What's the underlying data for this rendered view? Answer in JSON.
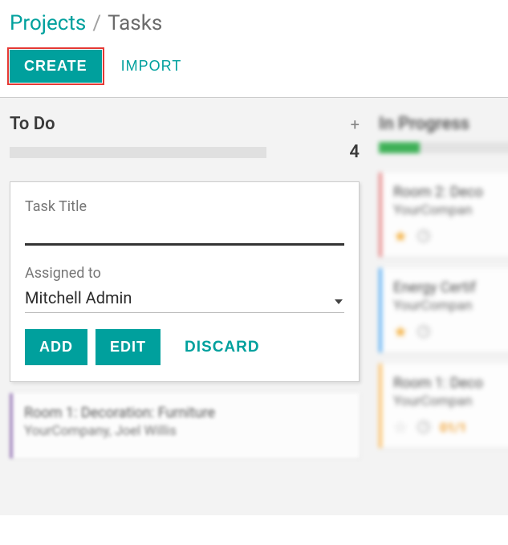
{
  "breadcrumb": {
    "root": "Projects",
    "sep": "/",
    "current": "Tasks"
  },
  "actions": {
    "create": "CREATE",
    "import": "IMPORT"
  },
  "columns": {
    "todo": {
      "title": "To Do",
      "count": "4",
      "form": {
        "title_label": "Task Title",
        "title_value": "",
        "assigned_label": "Assigned to",
        "assigned_value": "Mitchell Admin",
        "add": "ADD",
        "edit": "EDIT",
        "discard": "DISCARD"
      },
      "cards": [
        {
          "title": "Room 1: Decoration: Furniture",
          "sub": "YourCompany, Joel Willis"
        }
      ]
    },
    "progress": {
      "title": "In Progress",
      "cards": [
        {
          "title": "Room 2: Deco",
          "sub": "YourCompan",
          "starred": true
        },
        {
          "title": "Energy Certif",
          "sub": "YourCompan",
          "starred": true
        },
        {
          "title": "Room 1: Deco",
          "sub": "YourCompan",
          "starred": false,
          "date": "01/1"
        }
      ]
    }
  }
}
